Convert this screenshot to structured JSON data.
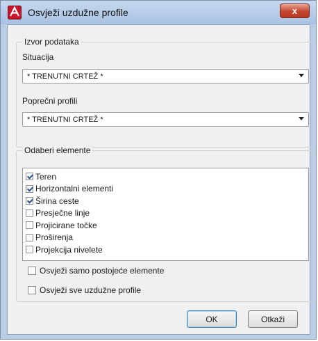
{
  "window": {
    "title": "Osvježi uzdužne profile",
    "close_label": "x"
  },
  "source_group": {
    "title": "Izvor podataka",
    "situation_label": "Situacija",
    "situation_value": "* TRENUTNI CRTEŽ *",
    "cross_label": "Poprečni profili",
    "cross_value": "* TRENUTNI CRTEŽ *"
  },
  "elements_group": {
    "title": "Odaberi elemente",
    "items": [
      {
        "label": "Teren",
        "checked": true
      },
      {
        "label": "Horizontalni elementi",
        "checked": true
      },
      {
        "label": "Širina ceste",
        "checked": true
      },
      {
        "label": "Presječne linje",
        "checked": false
      },
      {
        "label": "Projicirane točke",
        "checked": false
      },
      {
        "label": "Proširenja",
        "checked": false
      },
      {
        "label": "Projekcija nivelete",
        "checked": false
      }
    ],
    "refresh_existing_label": "Osvježi samo postojeće elemente",
    "refresh_existing_checked": false,
    "refresh_all_label": "Osvježi sve uzdužne profile",
    "refresh_all_checked": false
  },
  "buttons": {
    "ok": "OK",
    "cancel": "Otkaži"
  }
}
